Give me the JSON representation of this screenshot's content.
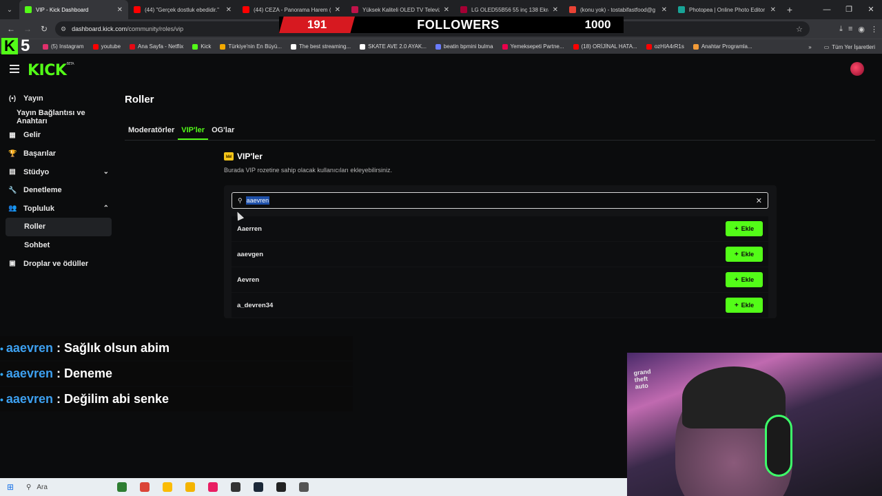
{
  "browser": {
    "tabs": [
      {
        "title": "VIP - Kick Dashboard",
        "color": "#53fc18",
        "active": true
      },
      {
        "title": "(44) \"Gerçek dostluk ebedidir.\"",
        "color": "#ff0000"
      },
      {
        "title": "(44) CEZA - Panorama Harem (",
        "color": "#ff0000"
      },
      {
        "title": "Yüksek Kaliteli OLED TV Televiz",
        "color": "#c0134a"
      },
      {
        "title": "LG OLED55B56 55 inç 138 Ekra",
        "color": "#a50034"
      },
      {
        "title": "(konu yok) - tostabifastfood@g",
        "color": "#ea4335"
      },
      {
        "title": "Photopea | Online Photo Editor",
        "color": "#18a497"
      }
    ],
    "new_tab": "+",
    "url_host": "dashboard.kick.com",
    "url_path": "/community/roles/vip",
    "bookmarks": [
      {
        "label": "(5) Instagram",
        "color": "#e1306c"
      },
      {
        "label": "youtube",
        "color": "#ff0000"
      },
      {
        "label": "Ana Sayfa - Netflix",
        "color": "#e50914"
      },
      {
        "label": "Kick",
        "color": "#53fc18"
      },
      {
        "label": "Türkiye'nin En Büyü...",
        "color": "#f2a900"
      },
      {
        "label": "The best streaming...",
        "color": "#ffffff"
      },
      {
        "label": "SKATE AVE 2.0 AYAK...",
        "color": "#ffffff"
      },
      {
        "label": "beatin bpmini bulma",
        "color": "#6a7cff"
      },
      {
        "label": "Yemeksepeti Partne...",
        "color": "#ea004b"
      },
      {
        "label": "(18) ORİJİNAL HATA...",
        "color": "#ff0000"
      },
      {
        "label": "ozHIA4rR1s",
        "color": "#ff0000"
      },
      {
        "label": "Anahtar Programla...",
        "color": "#f29b38"
      }
    ],
    "all_bookmarks": "Tüm Yer İşaretleri"
  },
  "overlay": {
    "followers_count": "191",
    "followers_label": "FOLLOWERS",
    "followers_goal": "1000",
    "channel_number": "5"
  },
  "kick": {
    "logo": "KICK",
    "logo_sup": "BETA"
  },
  "sidebar": {
    "items": [
      {
        "label": "Yayın",
        "icon": "(•)"
      },
      {
        "label": "Yayın Bağlantısı ve Anahtarı"
      },
      {
        "label": "Gelir",
        "icon": "▦"
      },
      {
        "label": "Başarılar",
        "icon": "🏆"
      },
      {
        "label": "Stüdyo",
        "icon": "▤",
        "chev": "⌄"
      },
      {
        "label": "Denetleme",
        "icon": "🔧"
      },
      {
        "label": "Topluluk",
        "icon": "👥",
        "chev": "⌃"
      },
      {
        "label": "Roller"
      },
      {
        "label": "Sohbet"
      },
      {
        "label": "Droplar ve ödüller",
        "icon": "▣"
      }
    ]
  },
  "main": {
    "title": "Roller",
    "tabs": [
      {
        "label": "Moderatörler"
      },
      {
        "label": "VIP'ler"
      },
      {
        "label": "OG'lar"
      }
    ],
    "vip_heading": "VIP'ler",
    "vip_desc": "Burada VIP rozetine sahip olacak kullanıcıları ekleyebilirsiniz.",
    "search_value": "aaevren",
    "add_label": "Ekle",
    "results": [
      "Aaerren",
      "aaevgen",
      "Aevren",
      "a_devren34"
    ]
  },
  "chat": [
    {
      "user": "aaevren",
      "message": ": Sağlık olsun abim"
    },
    {
      "user": "aaevren",
      "message": ": Deneme"
    },
    {
      "user": "aaevren",
      "message": ": Değilim abi senke"
    }
  ],
  "taskbar": {
    "search_placeholder": "Ara",
    "app_colors": [
      "#2e7d32",
      "#db4437",
      "#fbbc05",
      "#f4b400",
      "#e91e63",
      "#333333",
      "#1b2838",
      "#222222",
      "#555555"
    ]
  }
}
